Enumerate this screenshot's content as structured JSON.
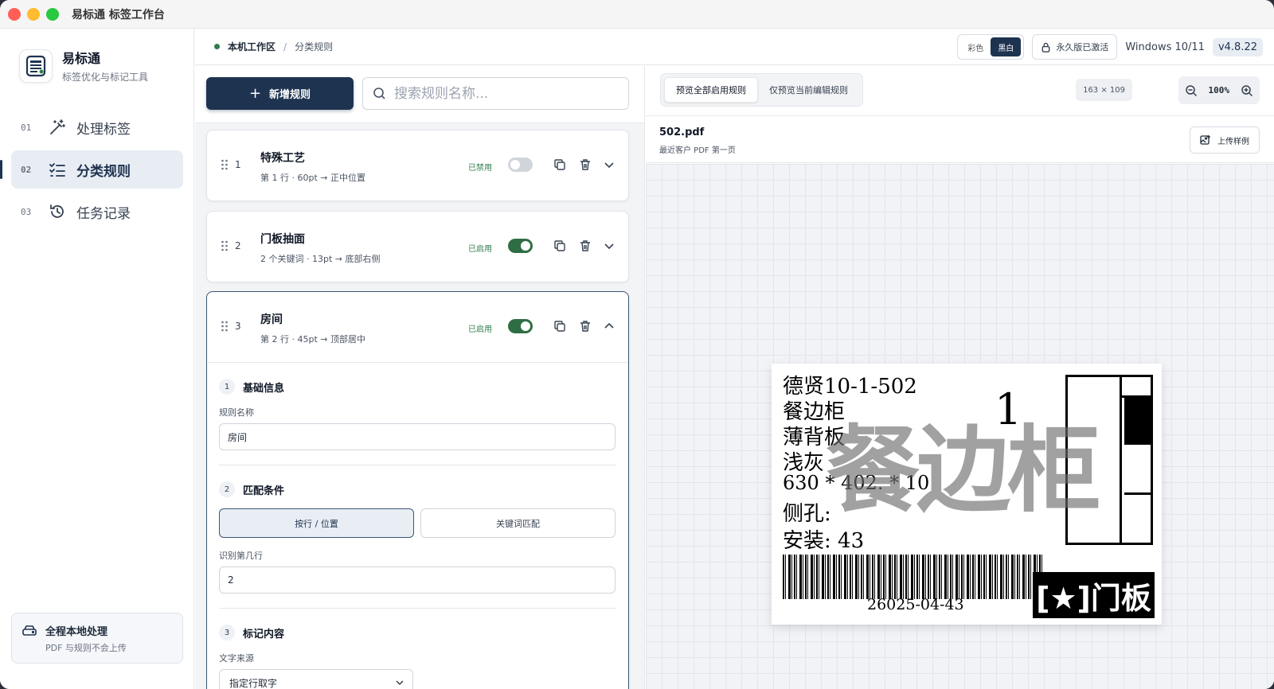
{
  "window": {
    "title": "易标通 标签工作台"
  },
  "brand": {
    "name": "易标通",
    "subtitle": "标签优化与标记工具"
  },
  "nav": {
    "items": [
      {
        "num": "01",
        "label": "处理标签",
        "icon": "magic-wand-icon"
      },
      {
        "num": "02",
        "label": "分类规则",
        "icon": "checklist-icon",
        "active": true
      },
      {
        "num": "03",
        "label": "任务记录",
        "icon": "history-icon"
      }
    ]
  },
  "local_card": {
    "title": "全程本地处理",
    "subtitle": "PDF 与规则不会上传"
  },
  "breadcrumb": {
    "root": "本机工作区",
    "sep": "/",
    "current": "分类规则"
  },
  "header": {
    "color_mode": {
      "color": "彩色",
      "bw": "黑白",
      "selected": "黑白"
    },
    "license": "永久版已激活",
    "os": "Windows 10/11",
    "version": "v4.8.22"
  },
  "rules": {
    "add_label": "新增规则",
    "search_placeholder": "搜索规则名称...",
    "items": [
      {
        "index": "1",
        "title": "特殊工艺",
        "subtitle": "第 1 行 · 60pt → 正中位置",
        "status": "已禁用",
        "enabled": false
      },
      {
        "index": "2",
        "title": "门板抽面",
        "subtitle": "2 个关键词 · 13pt → 底部右侧",
        "status": "已启用",
        "enabled": true
      },
      {
        "index": "3",
        "title": "房间",
        "subtitle": "第 2 行 · 45pt → 顶部居中",
        "status": "已启用",
        "enabled": true,
        "expanded": true
      }
    ],
    "editor": {
      "sec1": {
        "num": "1",
        "title": "基础信息",
        "name_label": "规则名称",
        "name_value": "房间"
      },
      "sec2": {
        "num": "2",
        "title": "匹配条件",
        "mode_line": "按行 / 位置",
        "mode_keyword": "关键词匹配",
        "line_label": "识别第几行",
        "line_value": "2"
      },
      "sec3": {
        "num": "3",
        "title": "标记内容",
        "source_label": "文字来源",
        "source_value": "指定行取字"
      }
    }
  },
  "preview": {
    "tab_all": "预览全部启用规则",
    "tab_current": "仅预览当前编辑规则",
    "dims": "163 × 109",
    "zoom": "100%",
    "file_name": "502.pdf",
    "file_sub": "最近客户 PDF 第一页",
    "upload_label": "上传样例"
  },
  "label": {
    "lines": [
      "德贤10-1-502",
      "餐边柜",
      "薄背板",
      "浅灰",
      "630   *   402.   *   10",
      "侧孔:",
      "安装: 43"
    ],
    "watermark": "餐边柜",
    "big_number": "1",
    "barcode_text": "26025-04-43",
    "badge": "[★]门板"
  }
}
